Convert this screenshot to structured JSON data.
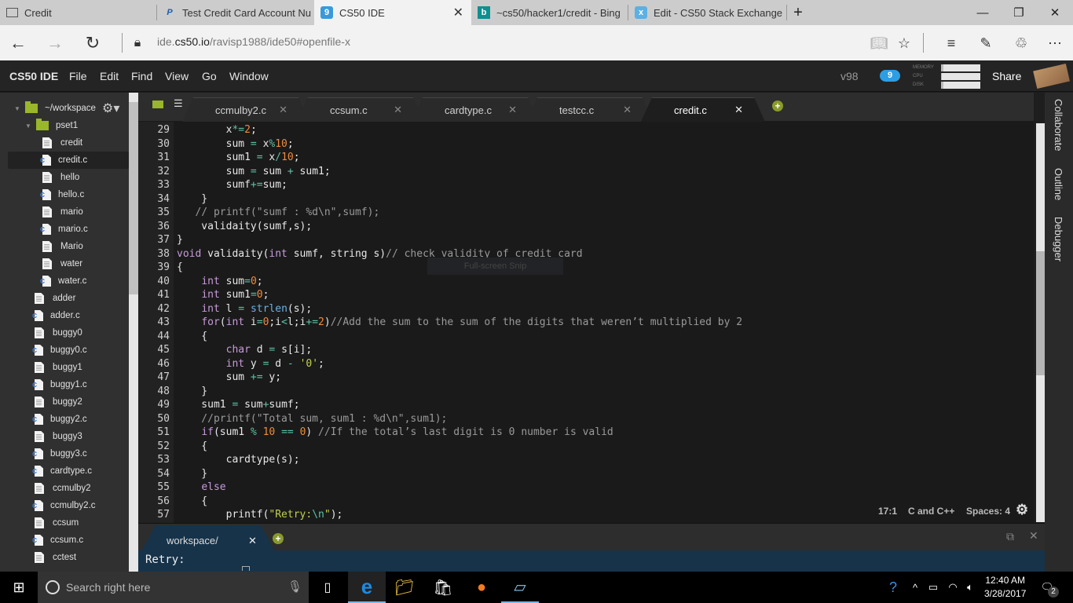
{
  "browser": {
    "tabs": [
      {
        "title": "Credit",
        "icon": "window-icon",
        "active": false
      },
      {
        "title": "Test Credit Card Account Nu",
        "icon": "paypal-icon",
        "active": false
      },
      {
        "title": "CS50 IDE",
        "icon": "cloud9-icon",
        "active": true
      },
      {
        "title": "~cs50/hacker1/credit - Bing",
        "icon": "bing-icon",
        "active": false
      },
      {
        "title": "Edit - CS50 Stack Exchange",
        "icon": "stackexchange-icon",
        "active": false
      }
    ],
    "new_tab": "+",
    "url_host_prefix": "ide.",
    "url_host_main": "cs50.io",
    "url_path": "/ravisp1988/ide50#openfile-x",
    "window_controls": {
      "minimize": "—",
      "restore": "❐",
      "close": "✕"
    }
  },
  "ide": {
    "menu": [
      "CS50 IDE",
      "File",
      "Edit",
      "Find",
      "View",
      "Go",
      "Window"
    ],
    "version": "v98",
    "notifications": "9",
    "stats": {
      "memory_label": "MEMORY",
      "cpu_label": "CPU",
      "disk_label": "DISK",
      "memory": 0.05,
      "cpu": 0.02,
      "disk": 0.05
    },
    "share": "Share"
  },
  "tree": {
    "root": "~/workspace",
    "folder": "pset1",
    "items": [
      {
        "name": "credit",
        "type": "file",
        "depth": 2
      },
      {
        "name": "credit.c",
        "type": "c",
        "depth": 2,
        "selected": true
      },
      {
        "name": "hello",
        "type": "file",
        "depth": 2
      },
      {
        "name": "hello.c",
        "type": "c",
        "depth": 2
      },
      {
        "name": "mario",
        "type": "file",
        "depth": 2
      },
      {
        "name": "mario.c",
        "type": "c",
        "depth": 2
      },
      {
        "name": "Mario",
        "type": "file",
        "depth": 2
      },
      {
        "name": "water",
        "type": "file",
        "depth": 2
      },
      {
        "name": "water.c",
        "type": "c",
        "depth": 2
      },
      {
        "name": "adder",
        "type": "file",
        "depth": 1
      },
      {
        "name": "adder.c",
        "type": "c",
        "depth": 1
      },
      {
        "name": "buggy0",
        "type": "file",
        "depth": 1
      },
      {
        "name": "buggy0.c",
        "type": "c",
        "depth": 1
      },
      {
        "name": "buggy1",
        "type": "file",
        "depth": 1
      },
      {
        "name": "buggy1.c",
        "type": "c",
        "depth": 1
      },
      {
        "name": "buggy2",
        "type": "file",
        "depth": 1
      },
      {
        "name": "buggy2.c",
        "type": "c",
        "depth": 1
      },
      {
        "name": "buggy3",
        "type": "file",
        "depth": 1
      },
      {
        "name": "buggy3.c",
        "type": "c",
        "depth": 1
      },
      {
        "name": "cardtype.c",
        "type": "c",
        "depth": 1
      },
      {
        "name": "ccmulby2",
        "type": "file",
        "depth": 1
      },
      {
        "name": "ccmulby2.c",
        "type": "c",
        "depth": 1
      },
      {
        "name": "ccsum",
        "type": "file",
        "depth": 1
      },
      {
        "name": "ccsum.c",
        "type": "c",
        "depth": 1
      },
      {
        "name": "cctest",
        "type": "file",
        "depth": 1
      }
    ]
  },
  "editor": {
    "tabs": [
      {
        "label": "ccmulby2.c",
        "active": false
      },
      {
        "label": "ccsum.c",
        "active": false
      },
      {
        "label": "cardtype.c",
        "active": false
      },
      {
        "label": "testcc.c",
        "active": false
      },
      {
        "label": "credit.c",
        "active": true
      }
    ],
    "lines": [
      {
        "n": "29",
        "tokens": [
          [
            "",
            "        x"
          ],
          [
            "op",
            "*="
          ],
          [
            "num",
            "2"
          ],
          [
            "",
            ";"
          ]
        ]
      },
      {
        "n": "30",
        "tokens": [
          [
            "",
            "        sum "
          ],
          [
            "op",
            "="
          ],
          [
            "",
            " x"
          ],
          [
            "op",
            "%"
          ],
          [
            "num",
            "10"
          ],
          [
            "",
            ";"
          ]
        ]
      },
      {
        "n": "31",
        "tokens": [
          [
            "",
            "        sum1 "
          ],
          [
            "op",
            "="
          ],
          [
            "",
            " x"
          ],
          [
            "op",
            "/"
          ],
          [
            "num",
            "10"
          ],
          [
            "",
            ";"
          ]
        ]
      },
      {
        "n": "32",
        "tokens": [
          [
            "",
            "        sum "
          ],
          [
            "op",
            "="
          ],
          [
            "",
            " sum "
          ],
          [
            "op",
            "+"
          ],
          [
            "",
            " sum1;"
          ]
        ]
      },
      {
        "n": "33",
        "tokens": [
          [
            "",
            "        sumf"
          ],
          [
            "op",
            "+="
          ],
          [
            "",
            "sum;"
          ]
        ]
      },
      {
        "n": "34",
        "tokens": [
          [
            "",
            "    }"
          ]
        ]
      },
      {
        "n": "35",
        "tokens": [
          [
            "cm",
            "   // printf(\"sumf : %d\\n\",sumf);"
          ]
        ]
      },
      {
        "n": "36",
        "tokens": [
          [
            "",
            "    validaity(sumf,s);"
          ]
        ]
      },
      {
        "n": "37",
        "tokens": [
          [
            "",
            "}"
          ]
        ]
      },
      {
        "n": "38",
        "tokens": [
          [
            "kw",
            "void"
          ],
          [
            "",
            " validaity("
          ],
          [
            "kw",
            "int"
          ],
          [
            "",
            " sumf, string s)"
          ],
          [
            "cm",
            "// check validity of credit card"
          ]
        ]
      },
      {
        "n": "39",
        "tokens": [
          [
            "",
            "{"
          ]
        ]
      },
      {
        "n": "40",
        "tokens": [
          [
            "",
            "    "
          ],
          [
            "kw",
            "int"
          ],
          [
            "",
            " sum"
          ],
          [
            "op",
            "="
          ],
          [
            "num",
            "0"
          ],
          [
            "",
            ";"
          ]
        ]
      },
      {
        "n": "41",
        "tokens": [
          [
            "",
            "    "
          ],
          [
            "kw",
            "int"
          ],
          [
            "",
            " sum1"
          ],
          [
            "op",
            "="
          ],
          [
            "num",
            "0"
          ],
          [
            "",
            ";"
          ]
        ]
      },
      {
        "n": "42",
        "tokens": [
          [
            "",
            "    "
          ],
          [
            "kw",
            "int"
          ],
          [
            "",
            " l "
          ],
          [
            "op",
            "="
          ],
          [
            "",
            " "
          ],
          [
            "fn",
            "strlen"
          ],
          [
            "",
            "(s);"
          ]
        ]
      },
      {
        "n": "43",
        "tokens": [
          [
            "",
            "    "
          ],
          [
            "kw",
            "for"
          ],
          [
            "",
            "("
          ],
          [
            "kw",
            "int"
          ],
          [
            "",
            " i"
          ],
          [
            "op",
            "="
          ],
          [
            "num",
            "0"
          ],
          [
            "",
            ";i"
          ],
          [
            "op",
            "<"
          ],
          [
            "",
            "l;i"
          ],
          [
            "op",
            "+="
          ],
          [
            "num",
            "2"
          ],
          [
            "",
            ")"
          ],
          [
            "cm",
            "//Add the sum to the sum of the digits that weren’t multiplied by 2"
          ]
        ]
      },
      {
        "n": "44",
        "tokens": [
          [
            "",
            "    {"
          ]
        ]
      },
      {
        "n": "45",
        "tokens": [
          [
            "",
            "        "
          ],
          [
            "kw",
            "char"
          ],
          [
            "",
            " d "
          ],
          [
            "op",
            "="
          ],
          [
            "",
            " s[i];"
          ]
        ]
      },
      {
        "n": "46",
        "tokens": [
          [
            "",
            "        "
          ],
          [
            "kw",
            "int"
          ],
          [
            "",
            " y "
          ],
          [
            "op",
            "="
          ],
          [
            "",
            " d "
          ],
          [
            "op",
            "-"
          ],
          [
            "",
            " "
          ],
          [
            "str",
            "'0'"
          ],
          [
            "",
            ";"
          ]
        ]
      },
      {
        "n": "47",
        "tokens": [
          [
            "",
            "        sum "
          ],
          [
            "op",
            "+="
          ],
          [
            "",
            " y;"
          ]
        ]
      },
      {
        "n": "48",
        "tokens": [
          [
            "",
            "    }"
          ]
        ]
      },
      {
        "n": "49",
        "tokens": [
          [
            "",
            "    sum1 "
          ],
          [
            "op",
            "="
          ],
          [
            "",
            " sum"
          ],
          [
            "op",
            "+"
          ],
          [
            "",
            "sumf;"
          ]
        ]
      },
      {
        "n": "50",
        "tokens": [
          [
            "cm",
            "    //printf(\"Total sum, sum1 : %d\\n\",sum1);"
          ]
        ]
      },
      {
        "n": "51",
        "tokens": [
          [
            "",
            "    "
          ],
          [
            "kw",
            "if"
          ],
          [
            "",
            "(sum1 "
          ],
          [
            "op",
            "%"
          ],
          [
            "",
            " "
          ],
          [
            "num",
            "10"
          ],
          [
            "",
            " "
          ],
          [
            "op",
            "=="
          ],
          [
            "",
            " "
          ],
          [
            "num",
            "0"
          ],
          [
            "",
            ") "
          ],
          [
            "cm",
            "//If the total’s last digit is 0 number is valid"
          ]
        ]
      },
      {
        "n": "52",
        "tokens": [
          [
            "",
            "    {"
          ]
        ]
      },
      {
        "n": "53",
        "tokens": [
          [
            "",
            "        cardtype(s);"
          ]
        ]
      },
      {
        "n": "54",
        "tokens": [
          [
            "",
            "    }"
          ]
        ]
      },
      {
        "n": "55",
        "tokens": [
          [
            "",
            "    "
          ],
          [
            "kw",
            "else"
          ]
        ]
      },
      {
        "n": "56",
        "tokens": [
          [
            "",
            "    {"
          ]
        ]
      },
      {
        "n": "57",
        "tokens": [
          [
            "",
            "        printf("
          ],
          [
            "str",
            "\"Retry:"
          ],
          [
            "op",
            "\\n"
          ],
          [
            "str",
            "\""
          ],
          [
            "",
            ");"
          ]
        ]
      }
    ],
    "snip_overlay": "Full-screen Snip",
    "status": {
      "position": "17:1",
      "language": "C and C++",
      "indent": "Spaces: 4"
    }
  },
  "right_rail": [
    "Collaborate",
    "Outline",
    "Debugger"
  ],
  "terminal": {
    "tab": "workspace/",
    "output": "Retry:"
  },
  "taskbar": {
    "search_placeholder": "Search right here",
    "apps": [
      "task-view",
      "edge",
      "file-explorer",
      "store",
      "firefox",
      "notepad"
    ],
    "time": "12:40 AM",
    "date": "3/28/2017",
    "notification_count": "2"
  }
}
